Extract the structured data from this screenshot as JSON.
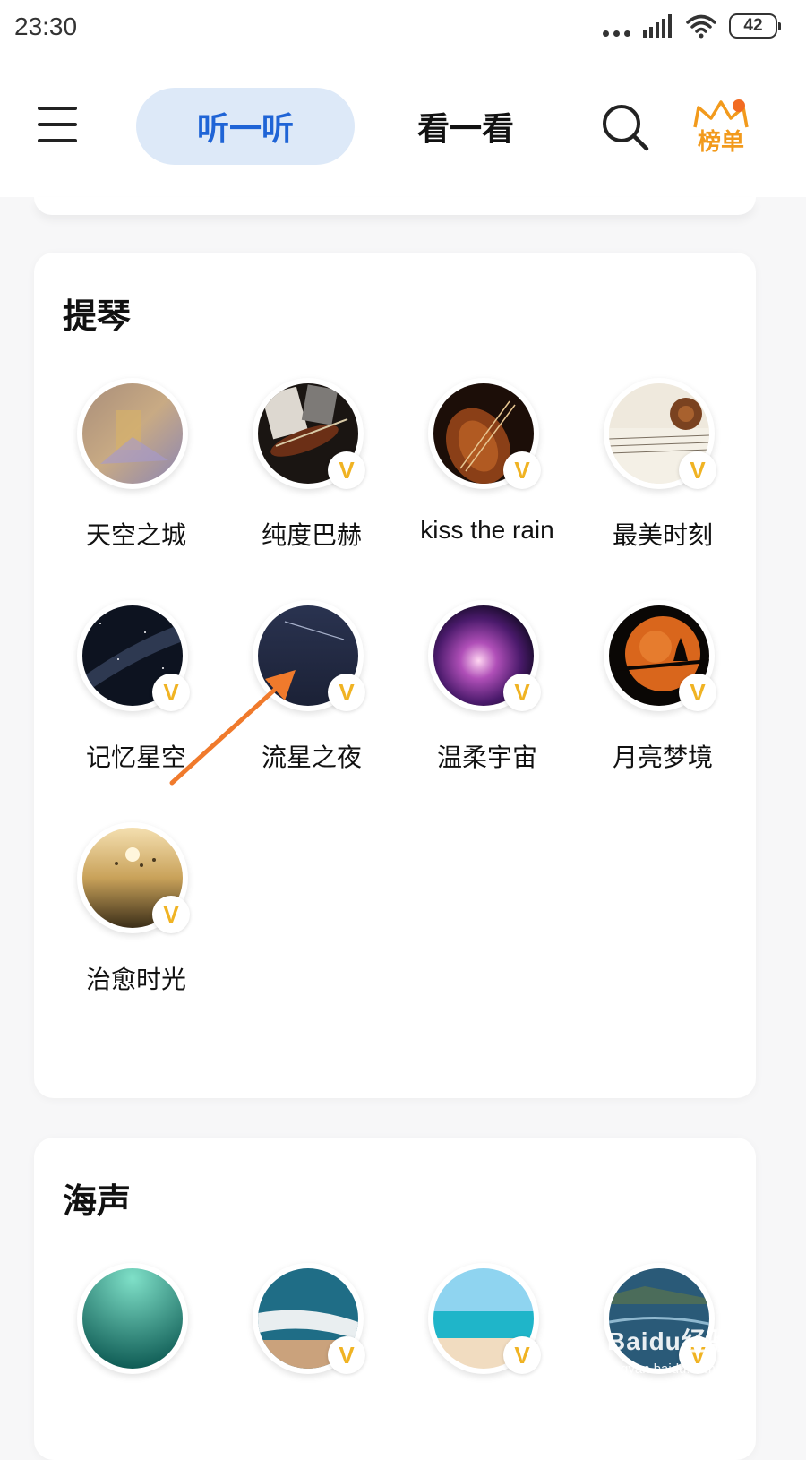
{
  "status_bar": {
    "time": "23:30",
    "battery": "42",
    "icons": [
      "more-dots-icon",
      "signal-icon",
      "wifi-icon",
      "battery-icon"
    ]
  },
  "header": {
    "tab_listen": "听一听",
    "tab_watch": "看一看",
    "rank_label": "榜单",
    "active_tab_color": "#1f64d6",
    "active_tab_bg": "#dde9f8",
    "accent_orange": "#f29a1c"
  },
  "sections": [
    {
      "title": "提琴",
      "items": [
        {
          "label": "天空之城",
          "vip": false
        },
        {
          "label": "纯度巴赫",
          "vip": true
        },
        {
          "label": "kiss the rain",
          "vip": true
        },
        {
          "label": "最美时刻",
          "vip": true
        },
        {
          "label": "记忆星空",
          "vip": true
        },
        {
          "label": "流星之夜",
          "vip": true
        },
        {
          "label": "温柔宇宙",
          "vip": true
        },
        {
          "label": "月亮梦境",
          "vip": true
        },
        {
          "label": "治愈时光",
          "vip": true
        }
      ]
    },
    {
      "title": "海声",
      "items": [
        {
          "vip": false
        },
        {
          "vip": true
        },
        {
          "vip": true
        },
        {
          "vip": true
        }
      ]
    }
  ],
  "vip_badge": "V",
  "annotation_arrow_color": "#f07a2c",
  "watermark": {
    "brand": "Baidu经验",
    "url": "jingyan.baidu.com"
  }
}
